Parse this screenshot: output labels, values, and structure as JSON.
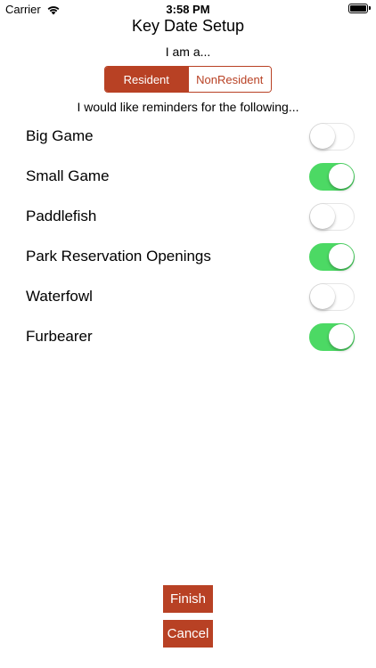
{
  "status_bar": {
    "carrier": "Carrier",
    "time": "3:58 PM",
    "wifi_icon": "wifi-icon",
    "battery_icon": "battery-icon"
  },
  "title": "Key Date Setup",
  "residency": {
    "prompt": "I am a...",
    "options": [
      "Resident",
      "NonResident"
    ],
    "selected": "Resident"
  },
  "reminders": {
    "prompt": "I would like reminders for the following...",
    "items": [
      {
        "label": "Big Game",
        "on": false
      },
      {
        "label": "Small Game",
        "on": true
      },
      {
        "label": "Paddlefish",
        "on": false
      },
      {
        "label": "Park Reservation Openings",
        "on": true
      },
      {
        "label": "Waterfowl",
        "on": false
      },
      {
        "label": "Furbearer",
        "on": true
      }
    ]
  },
  "buttons": {
    "finish": "Finish",
    "cancel": "Cancel"
  },
  "colors": {
    "accent": "#b84124",
    "toggle_on": "#4cd964",
    "toggle_off_border": "#e5e5e5"
  }
}
